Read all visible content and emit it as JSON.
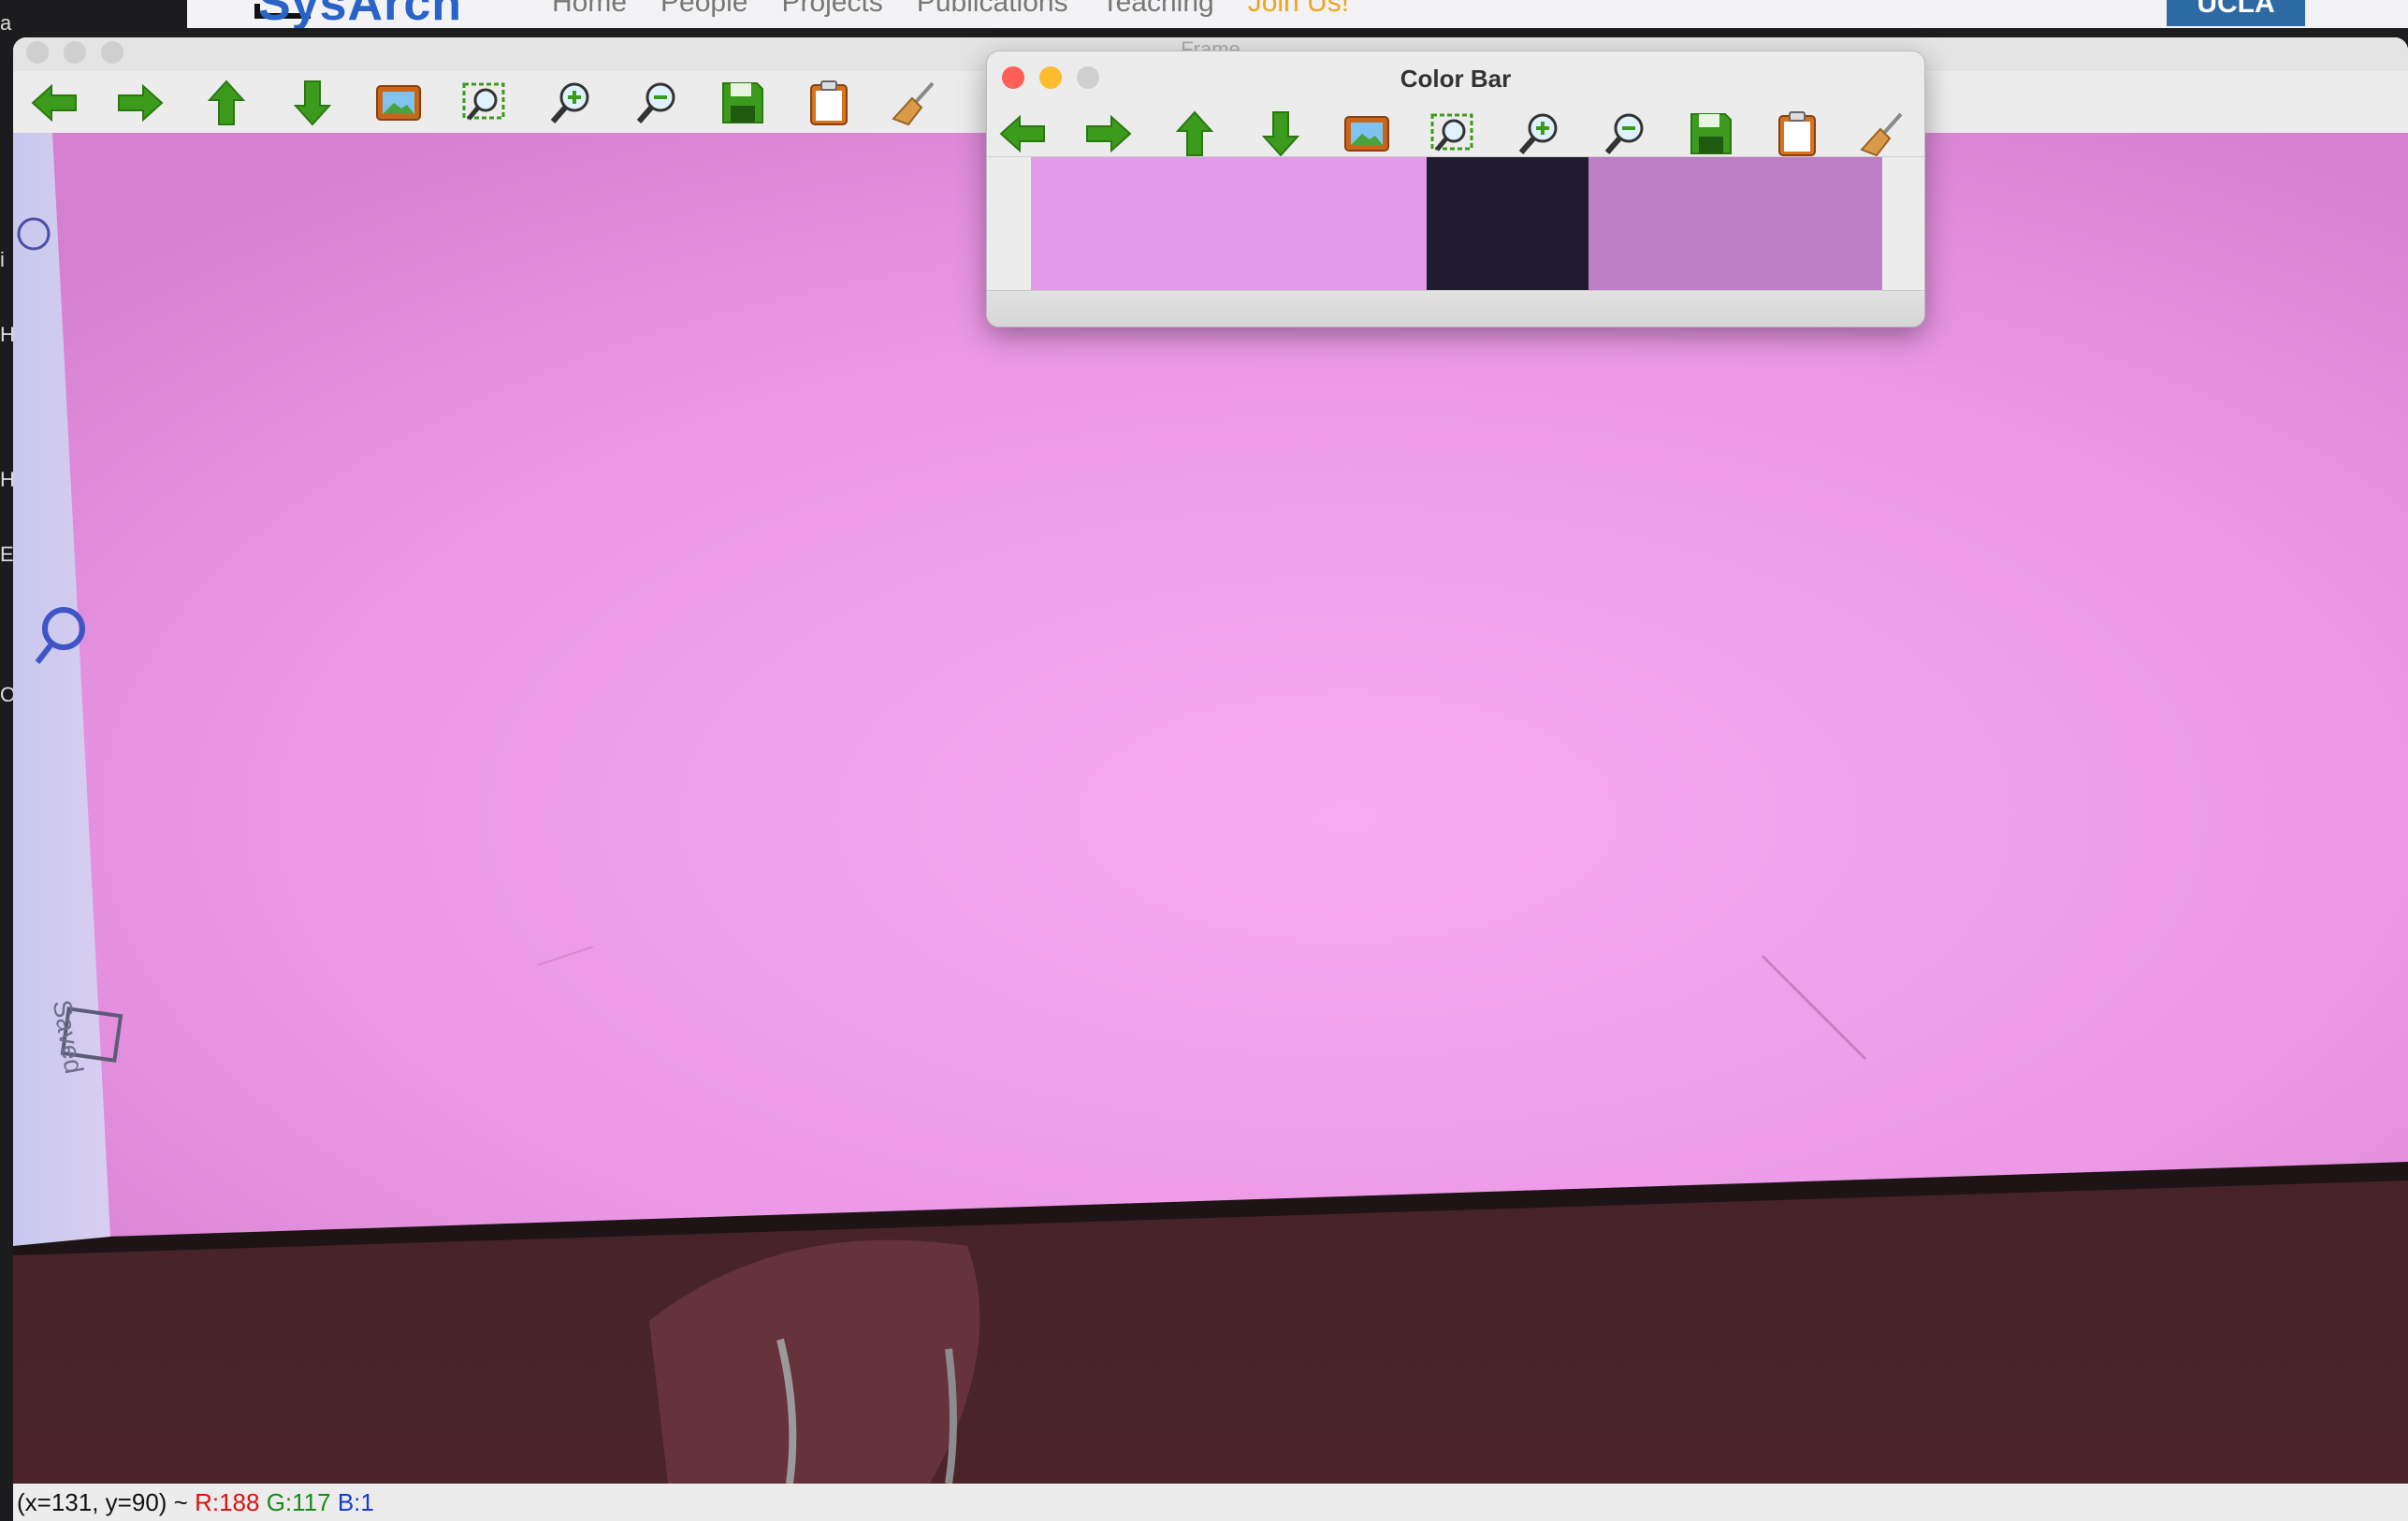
{
  "background_site": {
    "logo_text": "SysArch",
    "nav_items": [
      "Home",
      "People",
      "Projects",
      "Publications",
      "Teaching",
      "Join Us!"
    ],
    "badge": "UCLA"
  },
  "frame_window": {
    "title": "Frame",
    "toolbar_icons": [
      "arrow-left-icon",
      "arrow-right-icon",
      "arrow-up-icon",
      "arrow-down-icon",
      "image-icon",
      "zoom-fit-icon",
      "zoom-in-icon",
      "zoom-out-icon",
      "save-icon",
      "clipboard-icon",
      "broom-icon"
    ],
    "image_label": "Saved",
    "status": {
      "coords": "(x=131, y=90) ~",
      "r": "R:188",
      "g": "G:117",
      "b": "B:1"
    }
  },
  "color_bar_window": {
    "title": "Color Bar",
    "toolbar_icons": [
      "arrow-left-icon",
      "arrow-right-icon",
      "arrow-up-icon",
      "arrow-down-icon",
      "image-icon",
      "zoom-fit-icon",
      "zoom-in-icon",
      "zoom-out-icon",
      "save-icon",
      "clipboard-icon",
      "broom-icon"
    ],
    "swatches": [
      {
        "color": "#e39ae8",
        "share": 0.465
      },
      {
        "color": "#211b30",
        "share": 0.19
      },
      {
        "color": "#bd7ec6",
        "share": 0.345
      }
    ]
  },
  "colors": {
    "pink_screen": "#f5a6ee",
    "window_chrome": "#ececec",
    "close": "#ff5f57",
    "minimize": "#febc2e"
  }
}
